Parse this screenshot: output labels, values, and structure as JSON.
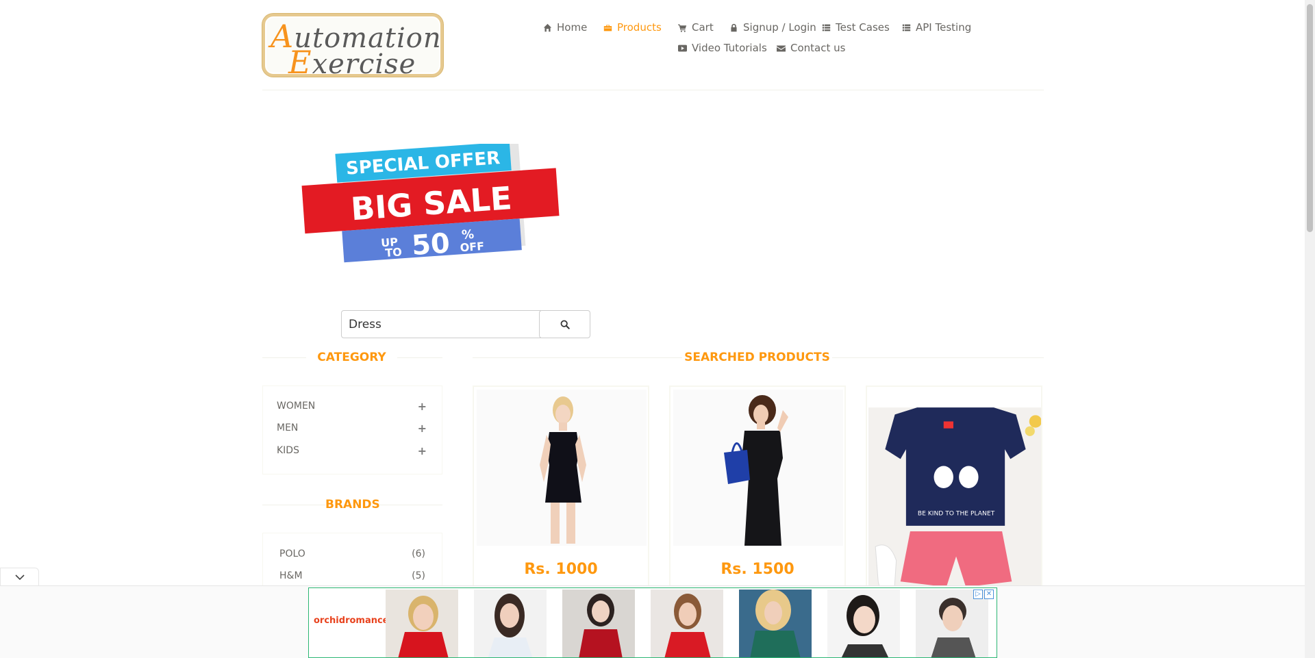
{
  "logo": {
    "line1_cap": "A",
    "line1_rest": "utomation",
    "line2_cap": "E",
    "line2_rest": "xercise"
  },
  "nav": {
    "home": "Home",
    "products": "Products",
    "cart": "Cart",
    "signup": "Signup / Login",
    "test_cases": "Test Cases",
    "api_testing": "API Testing",
    "video_tutorials": "Video Tutorials",
    "contact": "Contact us"
  },
  "banner": {
    "line1": "SPECIAL OFFER",
    "line2": "BIG SALE",
    "up": "UP",
    "to": "TO",
    "percent_value": "50",
    "percent_sign": "%",
    "off": "OFF"
  },
  "search": {
    "value": "Dress"
  },
  "sidebar": {
    "category_title": "CATEGORY",
    "categories": [
      "WOMEN",
      "MEN",
      "KIDS"
    ],
    "brands_title": "BRANDS",
    "brands": [
      {
        "name": "POLO",
        "count": "(6)"
      },
      {
        "name": "H&M",
        "count": "(5)"
      }
    ]
  },
  "main": {
    "title": "SEARCHED PRODUCTS",
    "products": [
      {
        "price": "Rs. 1000"
      },
      {
        "price": "Rs. 1500"
      },
      {
        "price": ""
      }
    ]
  },
  "ad": {
    "brand": "orchidromance"
  },
  "colors": {
    "accent": "#fe980f",
    "text": "#696763",
    "ad_border": "#2bb673"
  }
}
